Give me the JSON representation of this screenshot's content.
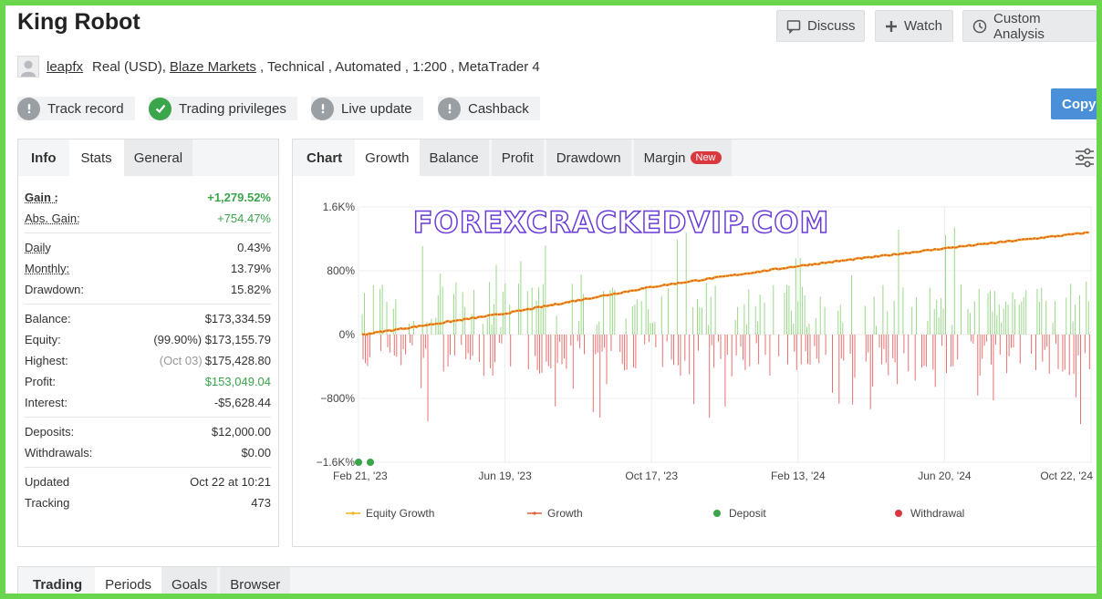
{
  "header": {
    "title": "King Robot",
    "buttons": {
      "discuss": "Discuss",
      "watch": "Watch",
      "custom_analysis": "Custom Analysis"
    },
    "user": "leapfx",
    "account_type": "Real (USD),",
    "broker": "Blaze Markets",
    "details": ", Technical , Automated , 1:200 , MetaTrader 4"
  },
  "badges": [
    {
      "label": "Track record",
      "status": "warning"
    },
    {
      "label": "Trading privileges",
      "status": "ok"
    },
    {
      "label": "Live update",
      "status": "warning"
    },
    {
      "label": "Cashback",
      "status": "warning"
    }
  ],
  "copy_label": "Copy",
  "left_tabs": [
    "Info",
    "Stats",
    "General"
  ],
  "stats": {
    "gain": {
      "label": "Gain :",
      "value": "+1,279.52%"
    },
    "abs_gain": {
      "label": "Abs. Gain:",
      "value": "+754.47%"
    },
    "daily": {
      "label": "Daily",
      "value": "0.43%"
    },
    "monthly": {
      "label": "Monthly:",
      "value": "13.79%"
    },
    "drawdown": {
      "label": "Drawdown:",
      "value": "15.82%"
    },
    "balance": {
      "label": "Balance:",
      "value": "$173,334.59"
    },
    "equity": {
      "label": "Equity:",
      "pct": "(99.90%)",
      "value": "$173,155.79"
    },
    "highest": {
      "label": "Highest:",
      "date": "(Oct 03)",
      "value": "$175,428.80"
    },
    "profit": {
      "label": "Profit:",
      "value": "$153,049.04"
    },
    "interest": {
      "label": "Interest:",
      "value": "-$5,628.44"
    },
    "deposits": {
      "label": "Deposits:",
      "value": "$12,000.00"
    },
    "withdrawals": {
      "label": "Withdrawals:",
      "value": "$0.00"
    },
    "updated": {
      "label": "Updated",
      "value": "Oct 22 at 10:21"
    },
    "tracking": {
      "label": "Tracking",
      "value": "473"
    }
  },
  "chart_tabs": {
    "chart": "Chart",
    "growth": "Growth",
    "balance": "Balance",
    "profit": "Profit",
    "drawdown": "Drawdown",
    "margin": "Margin",
    "new_badge": "New"
  },
  "watermark": "FOREXCRACKEDVIP.COM",
  "colors": {
    "growth": "#e06030",
    "equity": "#f0b020",
    "up_bars": "#9ad88a",
    "down_bars": "#e87070",
    "deposit": "#3aa54a",
    "withdrawal": "#d9383e",
    "copy_button": "#4a90d9"
  },
  "chart_data": {
    "type": "line",
    "x_tick_labels": [
      "Feb 21, '23",
      "Jun 19, '23",
      "Oct 17, '23",
      "Feb 13, '24",
      "Jun 20, '24",
      "Oct 22, '24"
    ],
    "y_tick_labels": [
      "1.6K%",
      "800%",
      "0%",
      "−800%",
      "−1.6K%"
    ],
    "ylim": [
      -1600,
      1600
    ],
    "series": [
      {
        "name": "Growth",
        "x": [
          "2023-02-21",
          "2023-06-19",
          "2023-10-17",
          "2024-02-13",
          "2024-06-20",
          "2024-10-22"
        ],
        "y": [
          0,
          270,
          600,
          860,
          1080,
          1280
        ]
      },
      {
        "name": "Equity Growth",
        "x": [
          "2023-02-21",
          "2023-06-19",
          "2023-10-17",
          "2024-02-13",
          "2024-06-20",
          "2024-10-22"
        ],
        "y": [
          0,
          270,
          600,
          860,
          1080,
          1279.5
        ]
      }
    ],
    "legend": [
      "Equity Growth",
      "Growth",
      "Deposit",
      "Withdrawal"
    ],
    "deposits": [
      "2023-02-21",
      "2023-03-01"
    ]
  },
  "bottom_tabs": [
    "Trading",
    "Periods",
    "Goals",
    "Browser"
  ]
}
